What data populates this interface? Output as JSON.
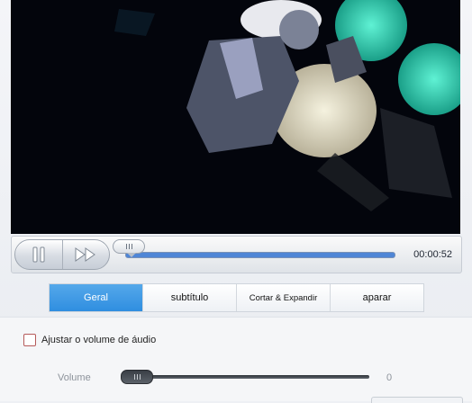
{
  "player": {
    "time": "00:00:52",
    "seek_progress": 0.01
  },
  "tabs": [
    {
      "label": "Geral",
      "active": true
    },
    {
      "label": "subtítulo",
      "active": false
    },
    {
      "label": "Cortar & Expandir",
      "active": false
    },
    {
      "label": "aparar",
      "active": false
    }
  ],
  "audio": {
    "adjust_label": "Ajustar o volume de áudio",
    "adjust_checked": false,
    "volume_label": "Volume",
    "volume_value": "0"
  },
  "icons": {
    "pause": "pause-icon",
    "fast_forward": "fast-forward-icon"
  },
  "colors": {
    "accent": "#3b95e3",
    "seek_fill": "#4f86d6"
  }
}
